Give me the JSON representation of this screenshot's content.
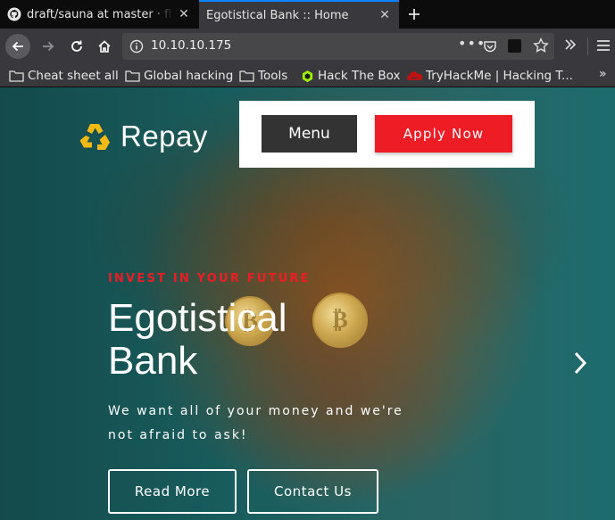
{
  "browser": {
    "tabs": [
      {
        "title": "draft/sauna at master · flu",
        "icon": "github-icon",
        "active": false
      },
      {
        "title": "Egotistical Bank :: Home",
        "icon": "none",
        "active": true
      }
    ],
    "url": "10.10.10.175",
    "bookmarks": [
      {
        "label": "Cheat sheet all",
        "icon": "folder-icon"
      },
      {
        "label": "Global hacking",
        "icon": "folder-icon"
      },
      {
        "label": "Tools",
        "icon": "folder-icon"
      },
      {
        "label": "Hack The Box",
        "icon": "hackthebox-icon"
      },
      {
        "label": "TryHackMe | Hacking T...",
        "icon": "tryhackme-icon"
      }
    ],
    "overflow_label": "»"
  },
  "site": {
    "logo_text": "Repay",
    "menu_label": "Menu",
    "apply_label": "Apply Now",
    "kicker": "INVEST IN YOUR FUTURE",
    "hero_title_line1": "Egotistical",
    "hero_title_line2": "Bank",
    "hero_subtitle": "We want all of your money and we're not afraid to ask!",
    "read_more_label": "Read More",
    "contact_label": "Contact Us"
  },
  "colors": {
    "accent_red": "#ee1c25",
    "teal_background": "#1c6b6c",
    "logo_yellow": "#f5b914",
    "browser_accent": "#0a84ff"
  }
}
